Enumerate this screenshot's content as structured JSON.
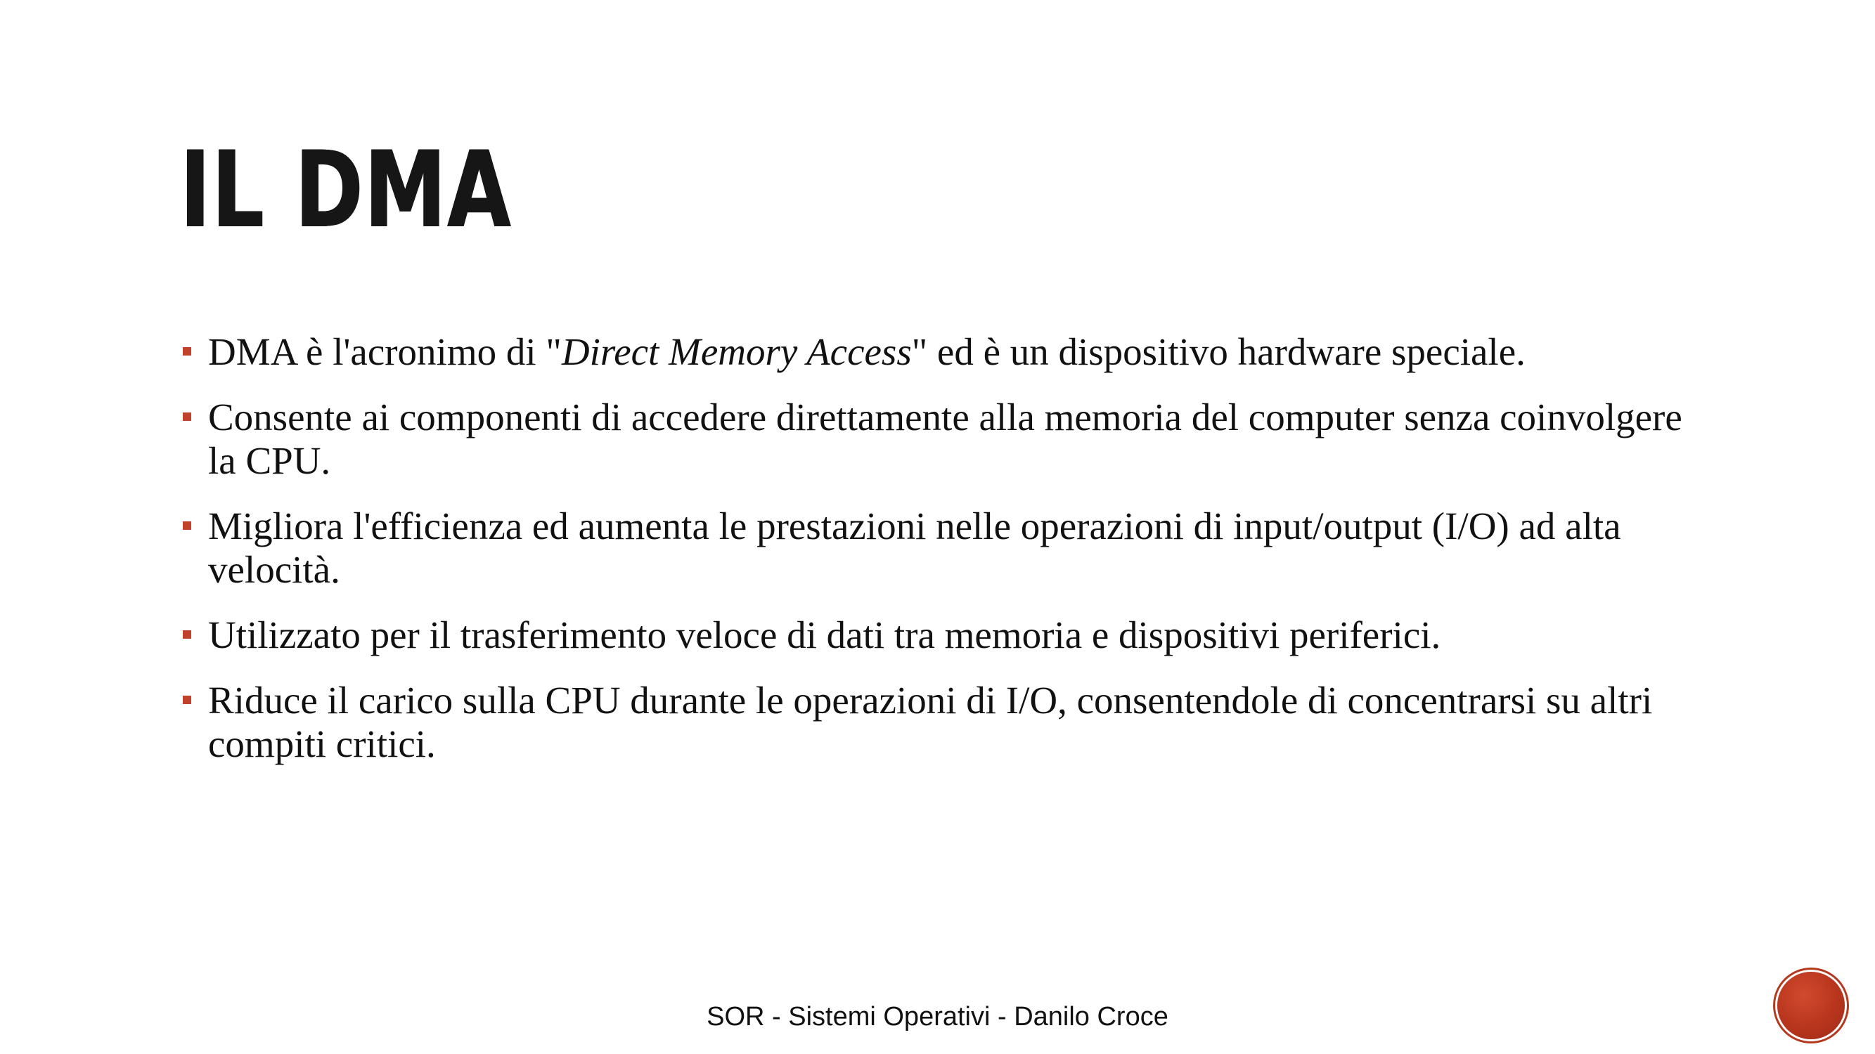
{
  "slide": {
    "title": "IL DMA",
    "bullets": [
      {
        "before": "DMA è l'acronimo di \"",
        "emphasis": "Direct Memory Access",
        "after": "\" ed è un dispositivo hardware speciale."
      },
      {
        "before": "Consente ai componenti di accedere direttamente alla memoria del computer senza coinvolgere la CPU.",
        "emphasis": "",
        "after": ""
      },
      {
        "before": "Migliora l'efficienza ed aumenta le prestazioni nelle operazioni di input/output (I/O) ad alta velocità.",
        "emphasis": "",
        "after": ""
      },
      {
        "before": "Utilizzato per il trasferimento veloce di dati tra memoria e dispositivi periferici.",
        "emphasis": "",
        "after": ""
      },
      {
        "before": "Riduce il carico sulla CPU durante le operazioni di I/O, consentendole di concentrarsi su altri compiti critici.",
        "emphasis": "",
        "after": ""
      }
    ],
    "footer": "SOR - Sistemi Operativi - Danilo Croce"
  },
  "colors": {
    "accent": "#c0422a",
    "text": "#111111",
    "background": "#ffffff"
  },
  "icons": {
    "bullet": "square-bullet-icon",
    "badge": "slide-badge-circle"
  }
}
